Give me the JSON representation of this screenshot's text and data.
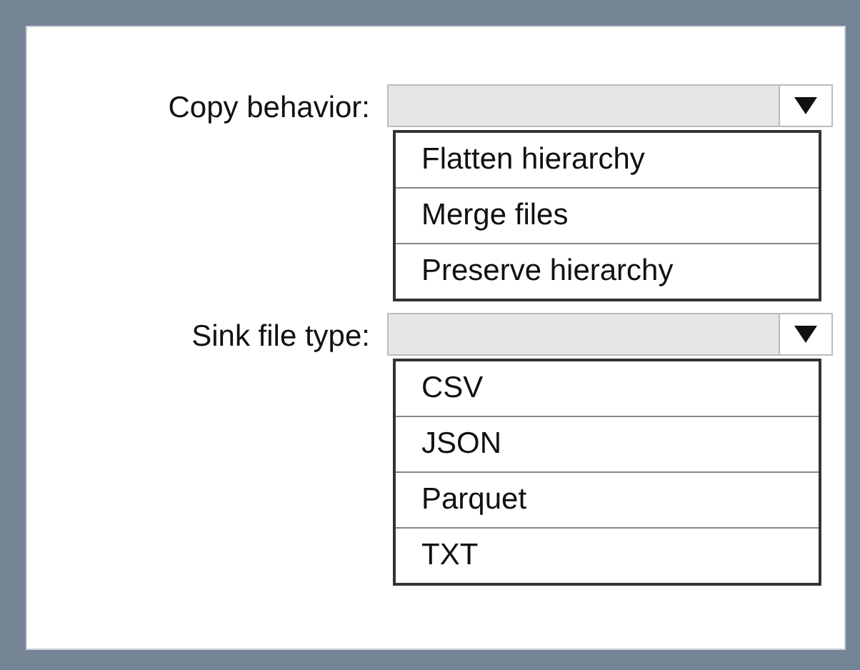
{
  "dropdowns": [
    {
      "label": "Copy behavior:",
      "options": [
        "Flatten hierarchy",
        "Merge files",
        "Preserve hierarchy"
      ]
    },
    {
      "label": "Sink file type:",
      "options": [
        "CSV",
        "JSON",
        "Parquet",
        "TXT"
      ]
    }
  ]
}
